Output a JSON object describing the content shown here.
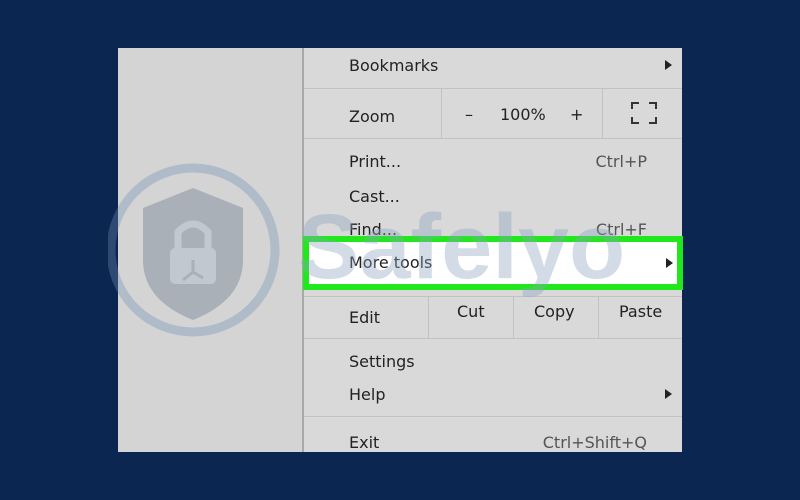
{
  "menu": {
    "bookmarks": "Bookmarks",
    "zoom": {
      "label": "Zoom",
      "minus": "–",
      "value": "100%",
      "plus": "+"
    },
    "print": {
      "label": "Print...",
      "shortcut": "Ctrl+P"
    },
    "cast": {
      "label": "Cast..."
    },
    "find": {
      "label": "Find...",
      "shortcut": "Ctrl+F"
    },
    "more_tools": {
      "label": "More tools"
    },
    "edit": {
      "label": "Edit",
      "cut": "Cut",
      "copy": "Copy",
      "paste": "Paste"
    },
    "settings": "Settings",
    "help": "Help",
    "exit": {
      "label": "Exit",
      "shortcut": "Ctrl+Shift+Q"
    }
  },
  "highlight_color": "#21e81c",
  "background_color": "#0b2650",
  "watermark": {
    "text": "Safelyo",
    "icon": "shield-lock-icon"
  }
}
